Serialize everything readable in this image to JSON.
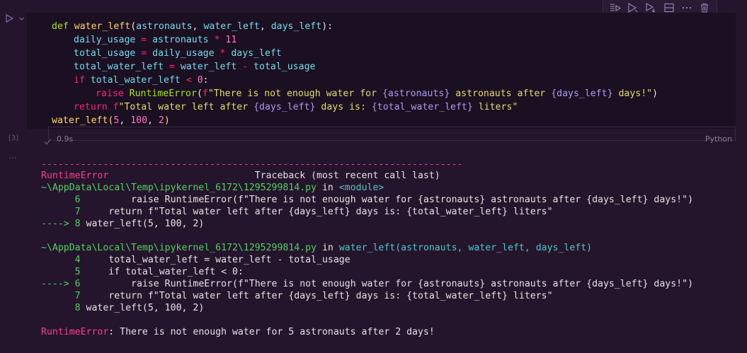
{
  "cell": {
    "execution_count": "[3]",
    "duration": "0.9s",
    "language": "Python"
  },
  "code": {
    "l1": {
      "def": "def",
      "fn": "water_left",
      "p1": "(",
      "a1": "astronauts",
      "c1": ", ",
      "a2": "water_left",
      "c2": ", ",
      "a3": "days_left",
      "p2": "):"
    },
    "l2": {
      "v1": "daily_usage",
      "eq": " = ",
      "v2": "astronauts",
      "op": " * ",
      "n": "11"
    },
    "l3": {
      "v1": "total_usage",
      "eq": " = ",
      "v2": "daily_usage",
      "op": " * ",
      "v3": "days_left"
    },
    "l4": {
      "v1": "total_water_left",
      "eq": " = ",
      "v2": "water_left",
      "op": " - ",
      "v3": "total_usage"
    },
    "l5": {
      "kw": "if",
      "sp": " ",
      "v1": "total_water_left",
      "op": " < ",
      "n": "0",
      "c": ":"
    },
    "l6": {
      "kw": "raise",
      "sp": " ",
      "cls": "RuntimeError",
      "p1": "(",
      "f": "f",
      "s1": "\"There is not enough water for ",
      "b1": "{astronauts}",
      "s2": " astronauts after ",
      "b2": "{days_left}",
      "s3": " days!\"",
      "p2": ")"
    },
    "l7": {
      "kw": "return",
      "sp": " ",
      "f": "f",
      "s1": "\"Total water left after ",
      "b1": "{days_left}",
      "s2": " days is: ",
      "b2": "{total_water_left}",
      "s3": " liters\""
    },
    "l8": {
      "fn": "water_left",
      "p1": "(",
      "n1": "5",
      "c1": ", ",
      "n2": "100",
      "c2": ", ",
      "n3": "2",
      "p2": ")"
    }
  },
  "output": {
    "dashes": "---------------------------------------------------------------------------",
    "err_name": "RuntimeError",
    "traceback_header": "                          Traceback (most recent call last)",
    "path1": "~\\AppData\\Local\\Temp\\ipykernel_6172\\1295299814.py",
    "in1": " in ",
    "mod1": "<module>",
    "f1_6_no": "      6 ",
    "f1_6_code": "        raise RuntimeError(f\"There is not enough water for {astronauts} astronauts after {days_left} days!\")",
    "f1_7_no": "      7 ",
    "f1_7_code": "    return f\"Total water left after {days_left} days is: {total_water_left} liters\"",
    "f1_8_arrow": "----> 8 ",
    "f1_8_code": "water_left(5, 100, 2)",
    "path2": "~\\AppData\\Local\\Temp\\ipykernel_6172\\1295299814.py",
    "in2": " in ",
    "mod2": "water_left(astronauts, water_left, days_left)",
    "f2_4_no": "      4 ",
    "f2_4_code": "    total_water_left = water_left - total_usage",
    "f2_5_no": "      5 ",
    "f2_5_code": "    if total_water_left < 0:",
    "f2_6_arrow": "----> 6 ",
    "f2_6_code": "        raise RuntimeError(f\"There is not enough water for {astronauts} astronauts after {days_left} days!\")",
    "f2_7_no": "      7 ",
    "f2_7_code": "    return f\"Total water left after {days_left} days is: {total_water_left} liters\"",
    "f2_8_no": "      8 ",
    "f2_8_code": "water_left(5, 100, 2)",
    "final_name": "RuntimeError",
    "final_msg": ": There is not enough water for 5 astronauts after 2 days!"
  },
  "icons": {
    "run": "play-icon",
    "run_menu": "chevron-down-icon",
    "toolbar": [
      "execute-above-icon",
      "execute-cell-icon",
      "execute-below-icon",
      "split-cell-icon",
      "more-icon",
      "delete-icon"
    ],
    "status": "check-icon",
    "output_menu": "ellipsis-icon"
  },
  "colors": {
    "background": "#24142c",
    "cell_background": "#1b0f22",
    "error": "#f4428c",
    "path": "#53d15e",
    "keyword": "#f92672",
    "function": "#ffd866",
    "variable": "#78dce8"
  }
}
